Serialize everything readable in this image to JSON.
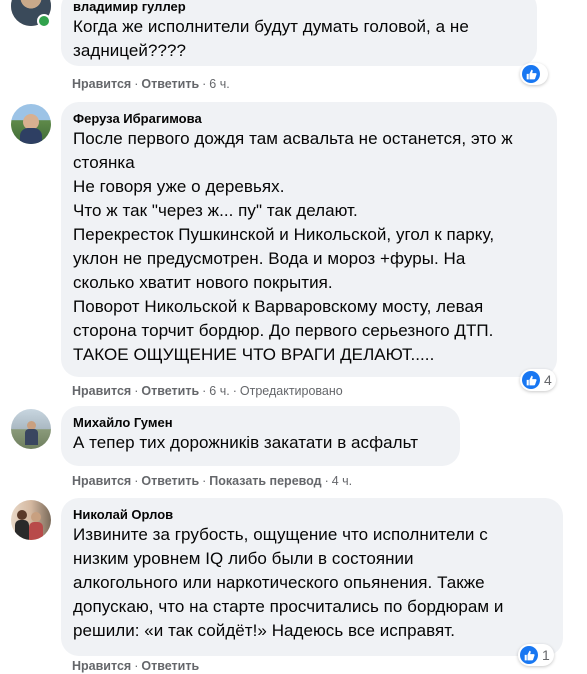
{
  "actions": {
    "like": "Нравится",
    "reply": "Ответить",
    "translate": "Показать перевод"
  },
  "comments": [
    {
      "author": "владимир гуллер",
      "text": "Когда же исполнители будут думать головой, а не\nзадницей????",
      "time": "6 ч.",
      "edited": "",
      "likes": "",
      "online": true
    },
    {
      "author": "Феруза Ибрагимова",
      "text": "После первого дождя там асвальта не останется, это ж\nстоянка\nНе говоря уже о деревьях.\nЧто ж так \"через ж... пу\" так делают.\nПерекресток Пушкинской и Никольской, угол к парку,\nуклон не предусмотрен. Вода и мороз +фуры. На\nсколько хватит нового покрытия.\nПоворот Никольской к Варваровскому мосту, левая\nсторона торчит бордюр. До первого серьезного ДТП.\nТАКОЕ ОЩУЩЕНИЕ ЧТО ВРАГИ ДЕЛАЮТ.....",
      "time": "6 ч.",
      "edited": "Отредактировано",
      "likes": "4",
      "online": false
    },
    {
      "author": "Михайло Гумен",
      "text": "А тепер тих дорожників закатати в асфальт",
      "time": "4 ч.",
      "edited": "",
      "likes": "",
      "online": false
    },
    {
      "author": "Николай Орлов",
      "text": "Извините за грубость, ощущение что исполнители с\nнизким уровнем IQ либо были в состоянии\nалкогольного или наркотического опьянения. Также\nдопускаю, что на старте просчитались по бордюрам и\nрешили: «и так сойдёт!» Надеюсь все исправят.",
      "time": "",
      "edited": "",
      "likes": "1",
      "online": false
    }
  ],
  "colors": {
    "bubble": "#f0f2f5",
    "meta": "#65676b",
    "like_blue": "#1877f2",
    "online_green": "#31a24c"
  }
}
